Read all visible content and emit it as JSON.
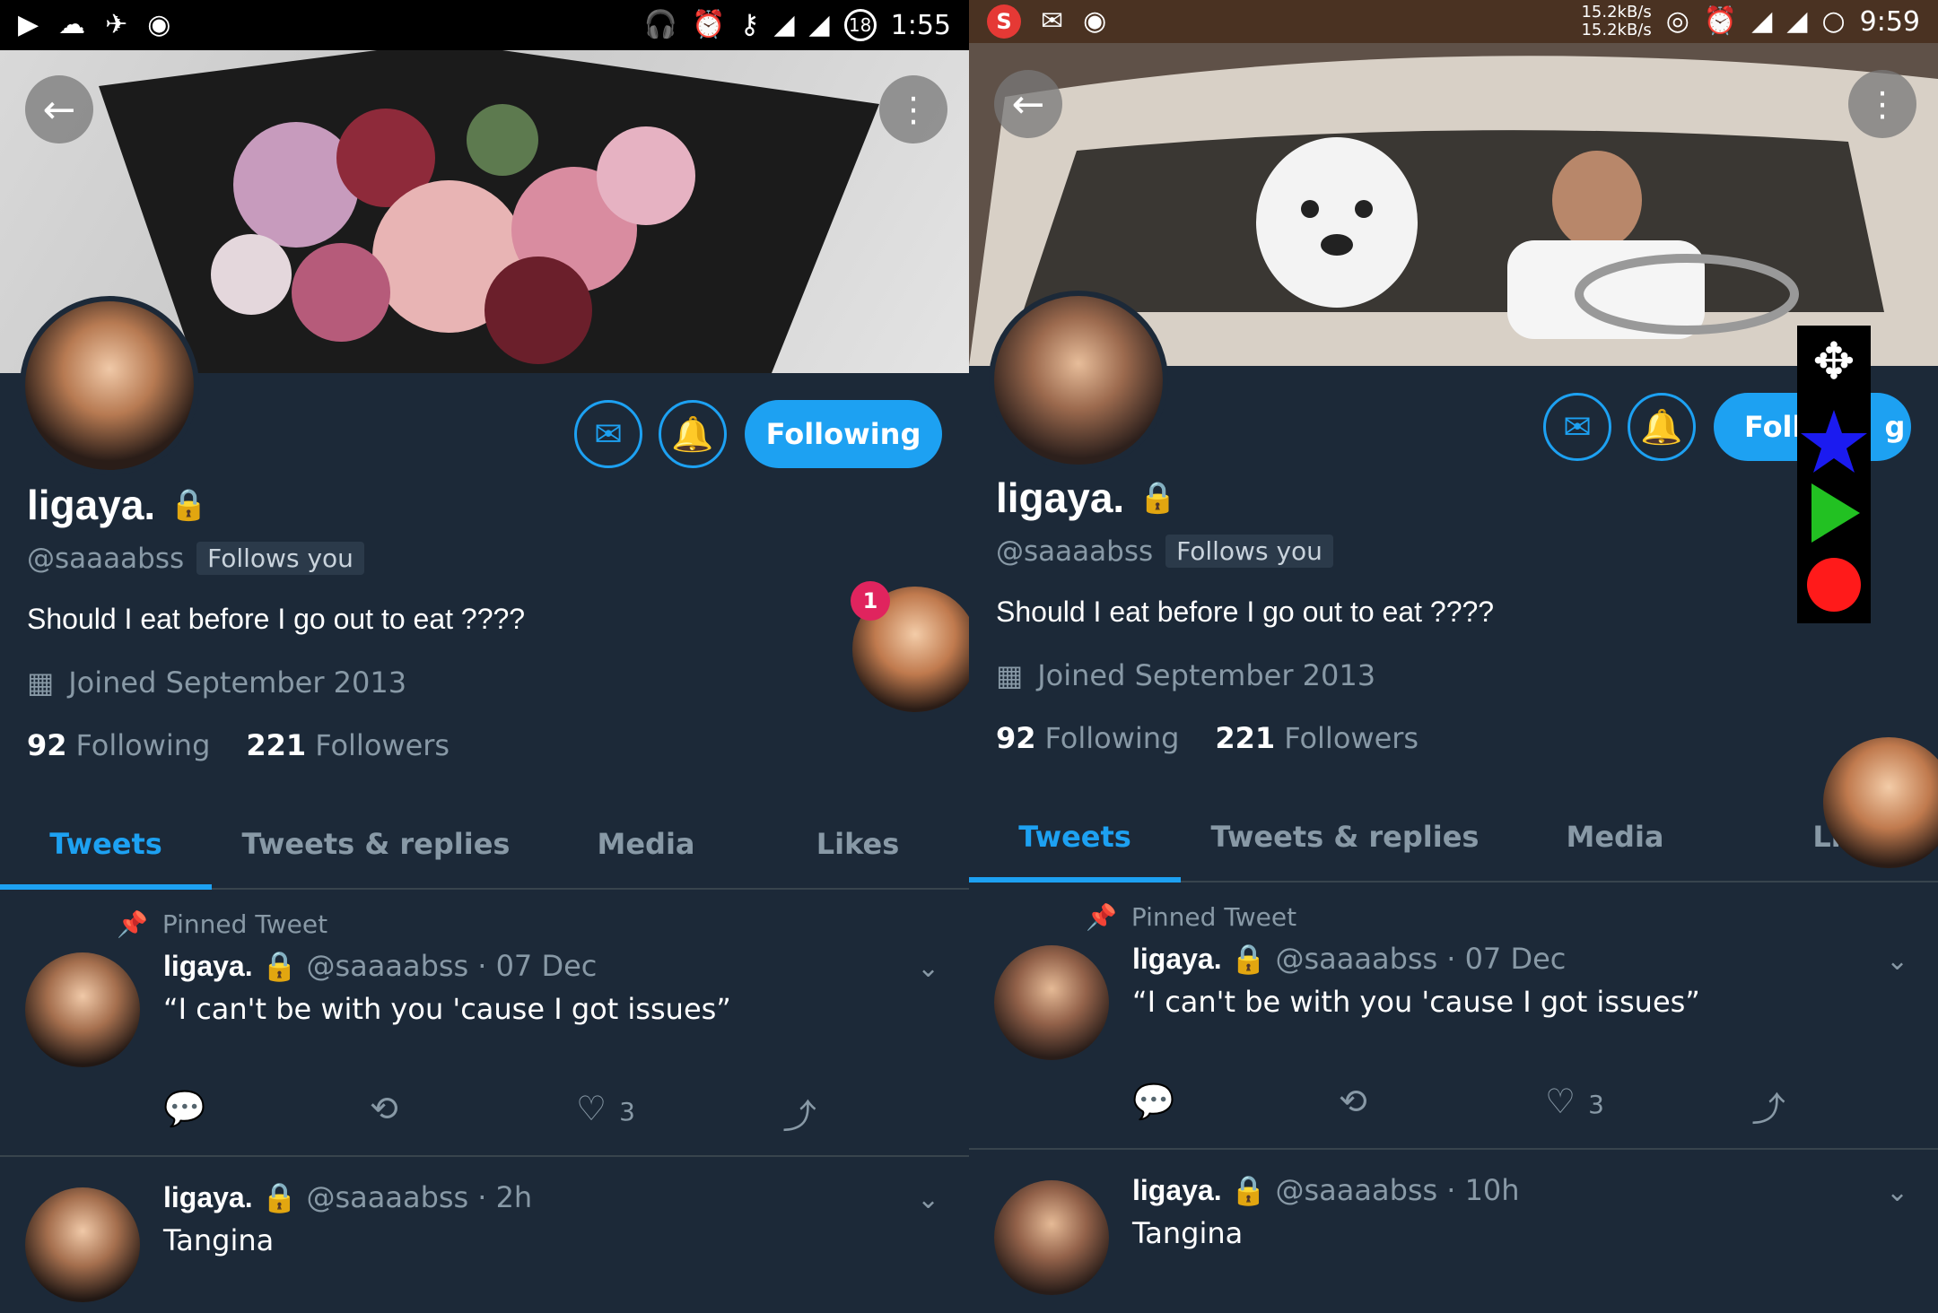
{
  "left": {
    "status": {
      "time": "1:55",
      "battery": "18"
    },
    "profile": {
      "name": "ligaya.",
      "handle": "@saaaabss",
      "follows_you": "Follows you",
      "bio": "Should I eat before I go out to eat ????",
      "joined": "Joined September 2013",
      "following_count": "92",
      "following_label": "Following",
      "followers_count": "221",
      "followers_label": "Followers",
      "follow_button": "Following"
    },
    "tabs": [
      "Tweets",
      "Tweets & replies",
      "Media",
      "Likes"
    ],
    "tweets": [
      {
        "pinned_label": "Pinned Tweet",
        "name": "ligaya.",
        "handle": "@saaaabss",
        "time": "· 07 Dec",
        "text": "“I can't be with you 'cause I got issues”",
        "likes": "3"
      },
      {
        "name": "ligaya.",
        "handle": "@saaaabss",
        "time": "· 2h",
        "text": "Tangina"
      }
    ],
    "chathead_badge": "1"
  },
  "right": {
    "status": {
      "time": "9:59",
      "speed_up": "15.2kB/s",
      "speed_down": "15.2kB/s",
      "s_icon": "S"
    },
    "profile": {
      "name": "ligaya.",
      "handle": "@saaaabss",
      "follows_you": "Follows you",
      "bio": "Should I eat before I go out to eat ????",
      "joined": "Joined September 2013",
      "following_count": "92",
      "following_label": "Following",
      "followers_count": "221",
      "followers_label": "Followers",
      "follow_button_visible": "Foll",
      "follow_button_tail": "g"
    },
    "tabs": [
      "Tweets",
      "Tweets & replies",
      "Media",
      "Li"
    ],
    "tweets": [
      {
        "pinned_label": "Pinned Tweet",
        "name": "ligaya.",
        "handle": "@saaaabss",
        "time": "· 07 Dec",
        "text": "“I can't be with you 'cause I got issues”",
        "likes": "3"
      },
      {
        "name": "ligaya.",
        "handle": "@saaaabss",
        "time": "· 10h",
        "text": "Tangina"
      }
    ]
  },
  "overlay_colors": {
    "star": "#1b1bf0",
    "play": "#22c122",
    "record": "#ff1a1a"
  },
  "accent": "#1da1f2"
}
